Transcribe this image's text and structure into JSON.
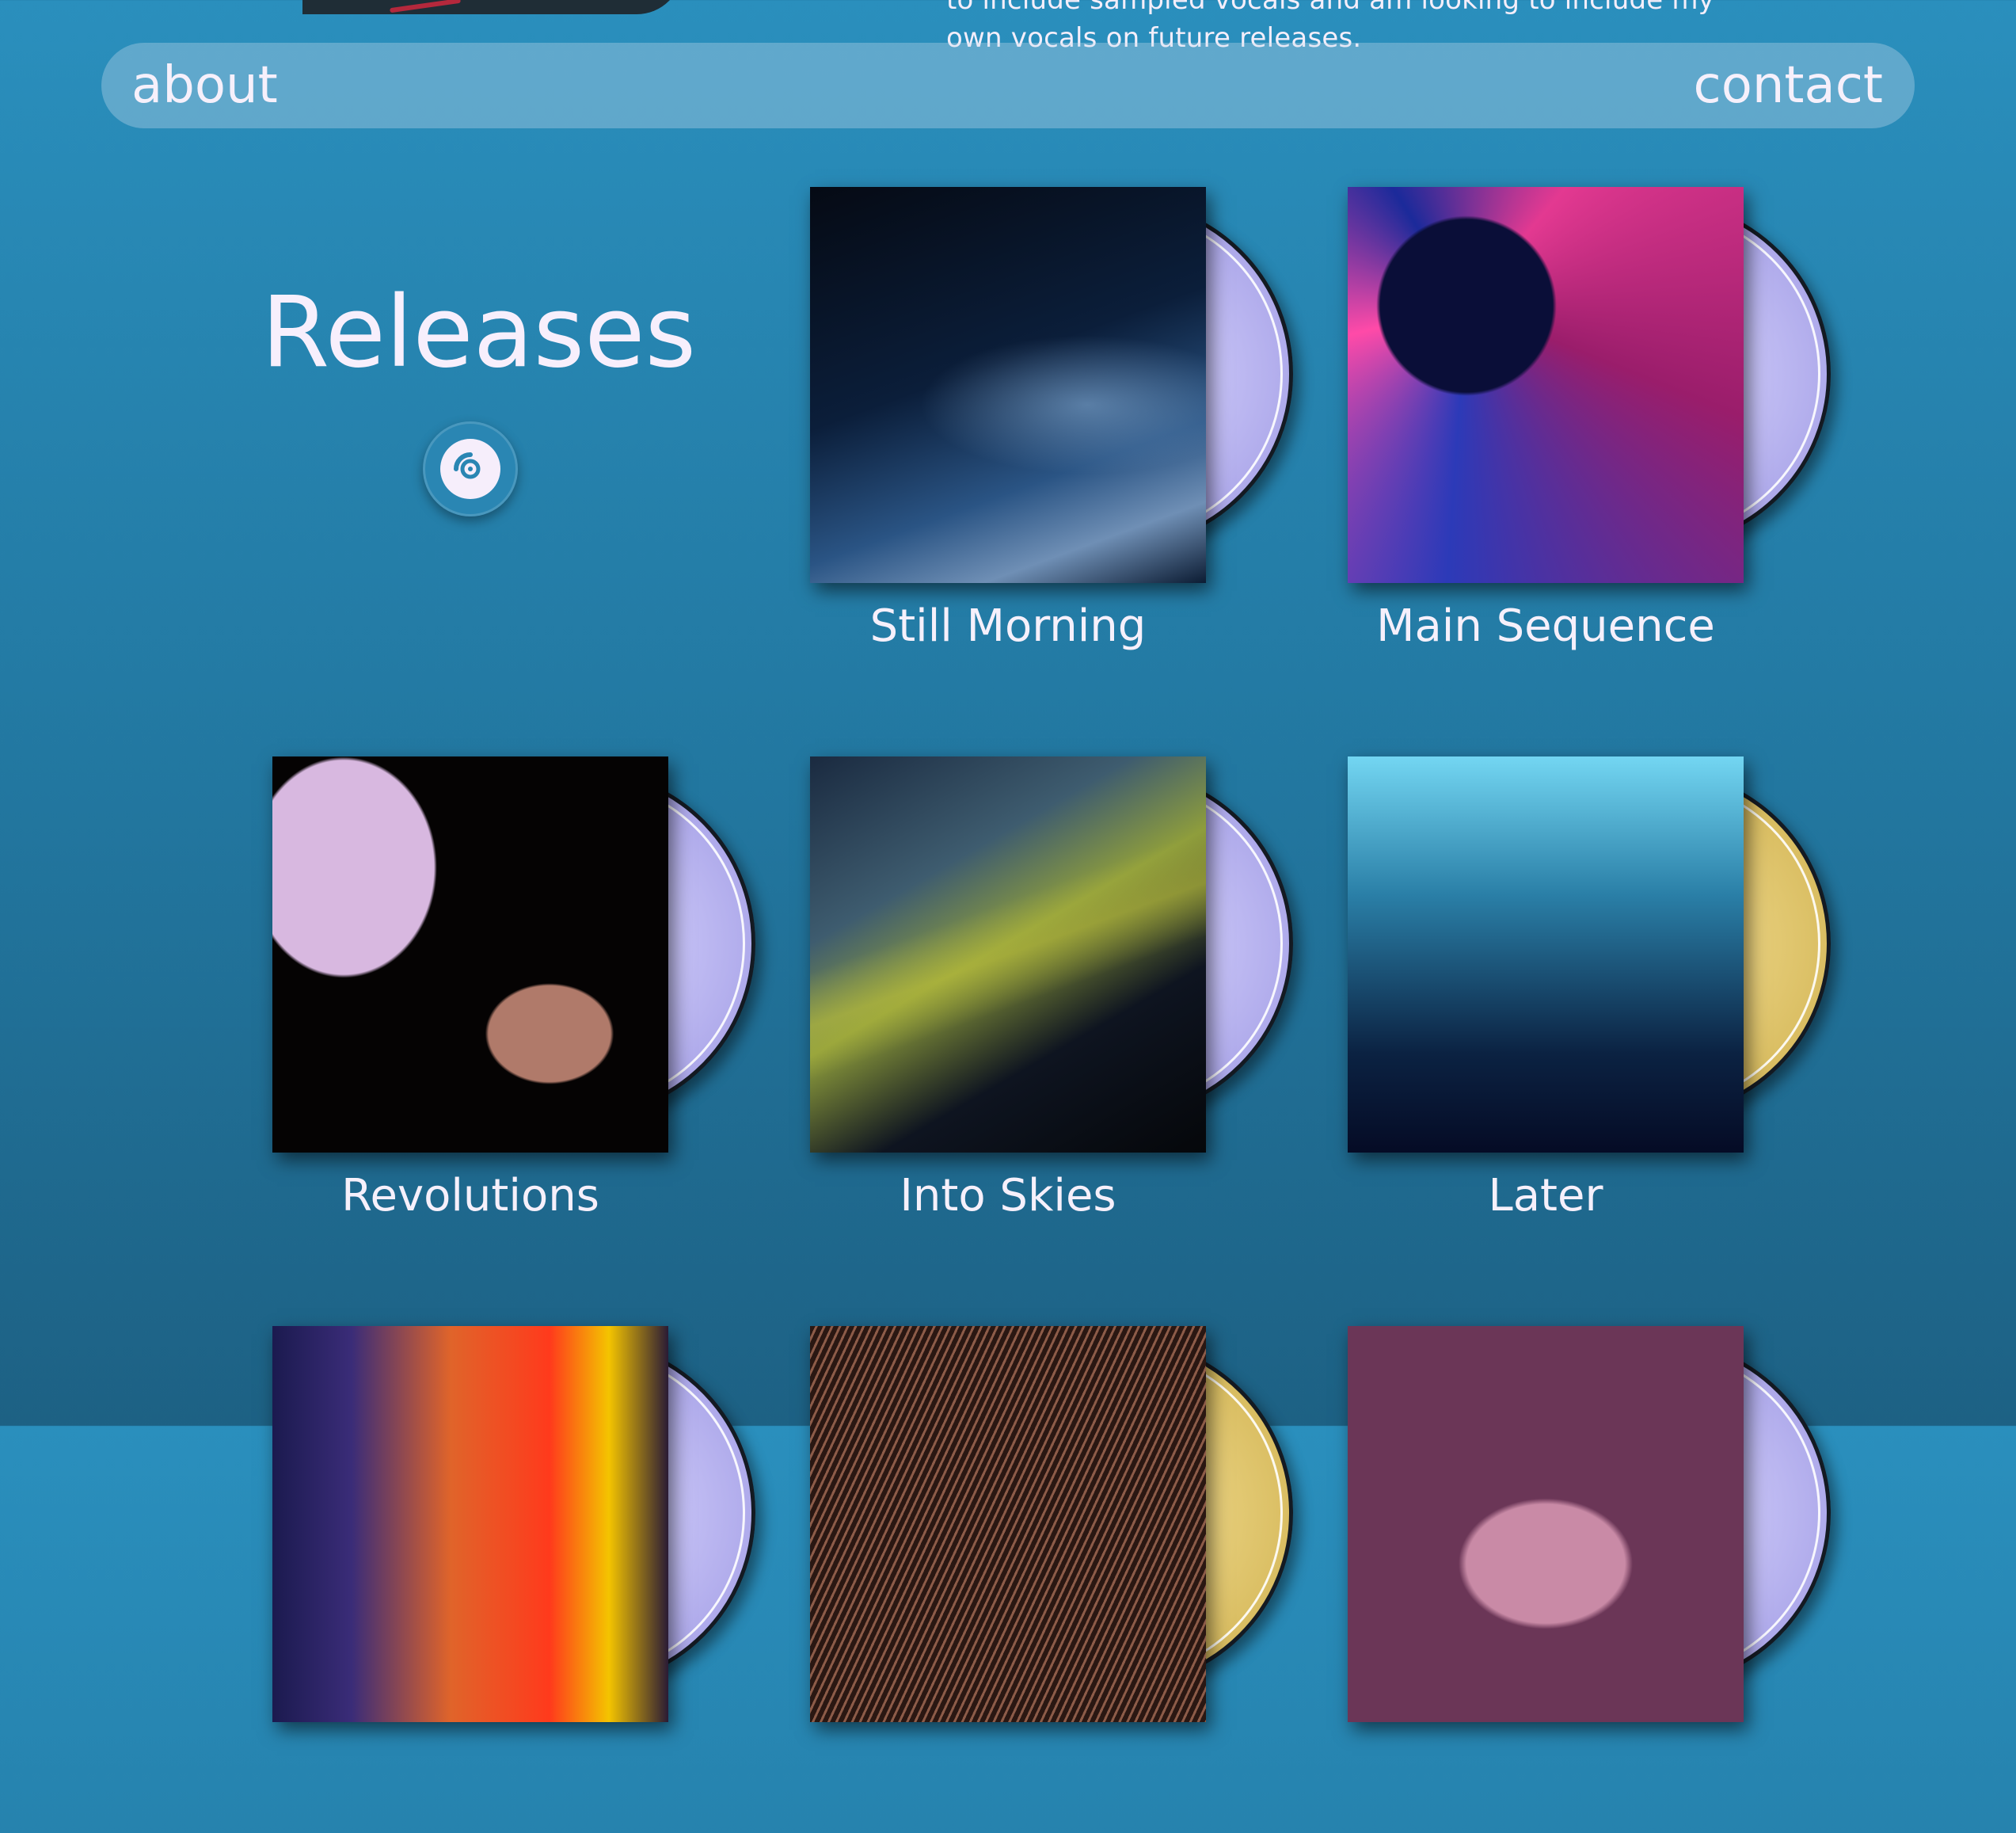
{
  "top_partial_text": {
    "line1": "to include sampled vocals and am looking to include my",
    "line2": "own vocals on future releases."
  },
  "nav": {
    "about": "about",
    "contact": "contact"
  },
  "releases_section": {
    "title": "Releases",
    "disc_icon": "disc-icon"
  },
  "releases": [
    {
      "title": "Still Morning",
      "cd_color": "#a9a4e8"
    },
    {
      "title": "Main Sequence",
      "cd_color": "#a9a4e8"
    },
    {
      "title": "Revolutions",
      "cd_color": "#a9a4e8"
    },
    {
      "title": "Into Skies",
      "cd_color": "#a9a4e8"
    },
    {
      "title": "Later",
      "cd_color": "#d6b95b"
    }
  ],
  "colors": {
    "background_top": "#2a8fbd",
    "background_bottom": "#1d6184",
    "text": "#f6f0fb"
  }
}
